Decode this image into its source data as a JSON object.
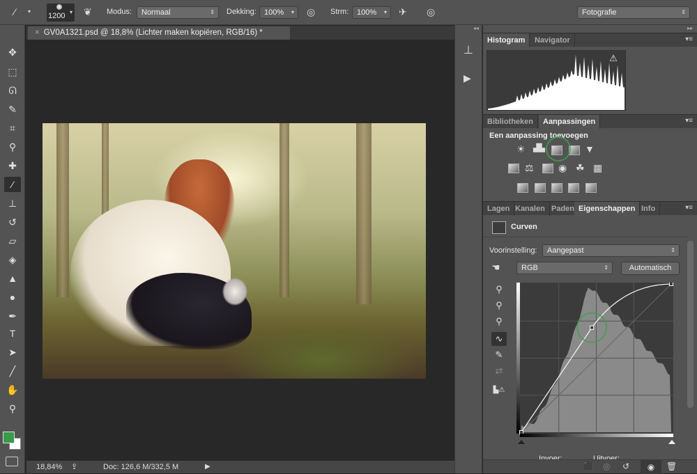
{
  "options_bar": {
    "brush_size": "1200",
    "mode_label": "Modus:",
    "mode_value": "Normaal",
    "opacity_label": "Dekking:",
    "opacity_value": "100%",
    "flow_label": "Strm:",
    "flow_value": "100%",
    "workspace": "Fotografie"
  },
  "document": {
    "tab_title": "GV0A1321.psd @ 18,8% (Lichter maken kopiëren, RGB/16) *",
    "zoom": "18,84%",
    "doc_info": "Doc: 126,6 M/332,5 M"
  },
  "panels": {
    "histogram_tabs": [
      "Histogram",
      "Navigator"
    ],
    "adjust_tabs": [
      "Bibliotheken",
      "Aanpassingen"
    ],
    "adjust_heading": "Een aanpassing toevoegen",
    "props_tabs": [
      "Lagen",
      "Kanalen",
      "Paden",
      "Eigenschappen",
      "Info"
    ],
    "props_title": "Curven",
    "preset_label": "Voorinstelling:",
    "preset_value": "Aangepast",
    "channel_value": "RGB",
    "auto_button": "Automatisch",
    "input_label": "Invoer:",
    "output_label": "Uitvoer:",
    "curve_points": [
      [
        0,
        0
      ],
      [
        120,
        180
      ],
      [
        255,
        255
      ]
    ]
  },
  "colors": {
    "foreground": "#3a9a4a",
    "background": "#ffffff",
    "highlight_circle": "#3fa04a"
  }
}
